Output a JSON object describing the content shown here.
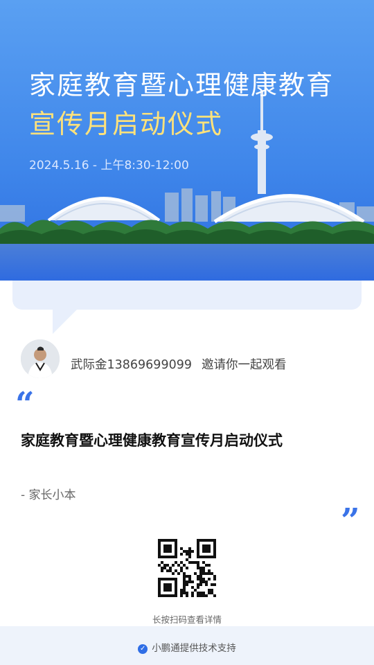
{
  "banner": {
    "title_line1": "家庭教育暨心理健康教育",
    "title_line2": "宣传月启动仪式",
    "datetime": "2024.5.16 - 上午8:30-12:00"
  },
  "inviter": {
    "name_phone": "武际金13869699099",
    "invite_text": "邀请你一起观看"
  },
  "quote": {
    "open_mark": "“",
    "event_title": "家庭教育暨心理健康教育宣传月启动仪式",
    "author": "- 家长小本",
    "close_mark": "”"
  },
  "qr": {
    "hint": "长按扫码查看详情"
  },
  "footer": {
    "support_text": "小鹏通提供技术支持"
  },
  "colors": {
    "accent": "#3a73e8",
    "banner_top": "#4e93ef",
    "banner_bottom": "#2c6de0",
    "title_yellow": "#ffe27a"
  }
}
